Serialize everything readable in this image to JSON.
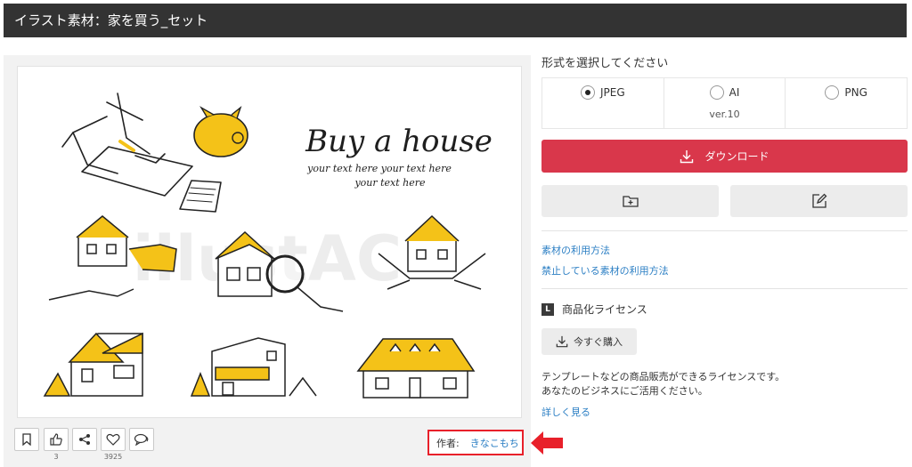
{
  "header": {
    "title": "イラスト素材：家を買う_セット"
  },
  "artwork": {
    "title": "Buy a house",
    "subtitle_line1": "your text here your text here",
    "subtitle_line2": "your text here",
    "watermark": "illustAC"
  },
  "actions": [
    {
      "icon": "bookmark-icon",
      "count": ""
    },
    {
      "icon": "thumbs-up-icon",
      "count": "3"
    },
    {
      "icon": "share-icon",
      "count": ""
    },
    {
      "icon": "heart-icon",
      "count": "3925"
    },
    {
      "icon": "comment-icon",
      "count": ""
    }
  ],
  "author": {
    "label": "作者:",
    "name": "きなこもち"
  },
  "format": {
    "heading": "形式を選択してください",
    "options": [
      {
        "label": "JPEG",
        "sub": "",
        "selected": true
      },
      {
        "label": "AI",
        "sub": "ver.10",
        "selected": false
      },
      {
        "label": "PNG",
        "sub": "",
        "selected": false
      }
    ]
  },
  "download": {
    "label": "ダウンロード",
    "color": "#d9374b"
  },
  "tools": {
    "left_icon": "folder-add-icon",
    "right_icon": "edit-icon"
  },
  "links": {
    "usage": "素材の利用方法",
    "prohibited": "禁止している素材の利用方法"
  },
  "license": {
    "badge": "L",
    "title": "商品化ライセンス",
    "buy_label": "今すぐ購入",
    "desc_line1": "テンプレートなどの商品販売ができるライセンスです。",
    "desc_line2": "あなたのビジネスにご活用ください。",
    "more": "詳しく見る"
  },
  "accent_colors": {
    "house_yellow": "#f4c218",
    "highlight_red": "#e8202a",
    "link_blue": "#2c7fc4"
  }
}
